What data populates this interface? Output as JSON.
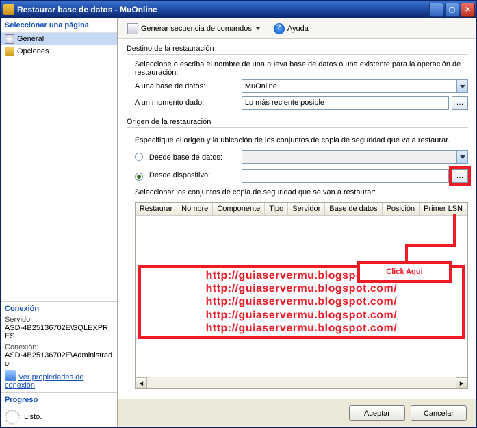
{
  "title": "Restaurar base de datos - MuOnline",
  "sidebar": {
    "select_page": "Seleccionar una página",
    "items": [
      {
        "label": "General"
      },
      {
        "label": "Opciones"
      }
    ],
    "conn_title": "Conexión",
    "server_label": "Servidor:",
    "server_value": "ASD-4B25136702E\\SQLEXPRES",
    "conn_label": "Conexión:",
    "conn_value": "ASD-4B25136702E\\Administrador",
    "view_props": "Ver propiedades de conexión",
    "progress_title": "Progreso",
    "progress_status": "Listo."
  },
  "toolbar": {
    "script": "Generar secuencia de comandos",
    "help": "Ayuda"
  },
  "dest": {
    "title": "Destino de la restauración",
    "help": "Seleccione o escriba el nombre de una nueva base de datos o una existente para la operación de restauración.",
    "db_label": "A una base de datos:",
    "db_value": "MuOnline",
    "time_label": "A un momento dado:",
    "time_value": "Lo más reciente posible"
  },
  "origin": {
    "title": "Origen de la restauración",
    "help": "Especifique el origen y la ubicación de los conjuntos de copia de seguridad que va a restaurar.",
    "from_db": "Desde base de datos:",
    "from_device": "Desde dispositivo:",
    "device_value": "",
    "sets_label": "Seleccionar los conjuntos de copia de seguridad que se van a restaurar:"
  },
  "grid": {
    "cols": [
      "Restaurar",
      "Nombre",
      "Componente",
      "Tipo",
      "Servidor",
      "Base de datos",
      "Posición",
      "Primer LSN"
    ]
  },
  "callout_text": "Click  Aqui",
  "watermark": "http://guiaservermu.blogspot.com/",
  "buttons": {
    "ok": "Aceptar",
    "cancel": "Cancelar"
  }
}
